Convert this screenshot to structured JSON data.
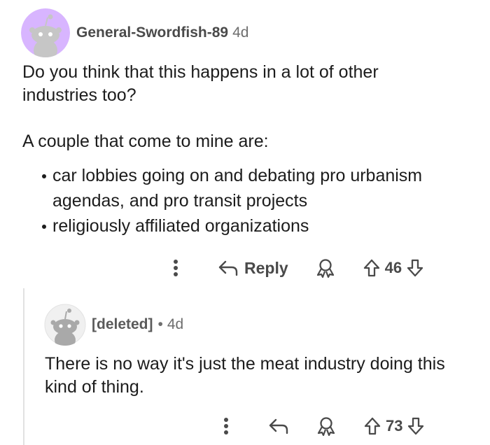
{
  "parent": {
    "username": "General-Swordfish-89",
    "age": "4d",
    "paragraph1": "Do you think that this happens in a lot of other industries too?",
    "paragraph2": "A couple that come to mine are:",
    "bullets": [
      "car lobbies going on and debating pro urbanism agendas, and pro transit projects",
      "religiously affiliated organizations"
    ],
    "reply_label": "Reply",
    "score": "46",
    "avatar_color": "#d8b5ff"
  },
  "child": {
    "username": "[deleted]",
    "separator": "•",
    "age": "4d",
    "text": "There is no way it's just the meat industry doing this kind of thing.",
    "score": "73",
    "avatar_color": "#e8e8e8"
  },
  "icons": {
    "more": "more-options-icon",
    "reply": "reply-arrow-icon",
    "award": "award-icon",
    "upvote": "upvote-arrow-icon",
    "downvote": "downvote-arrow-icon"
  }
}
